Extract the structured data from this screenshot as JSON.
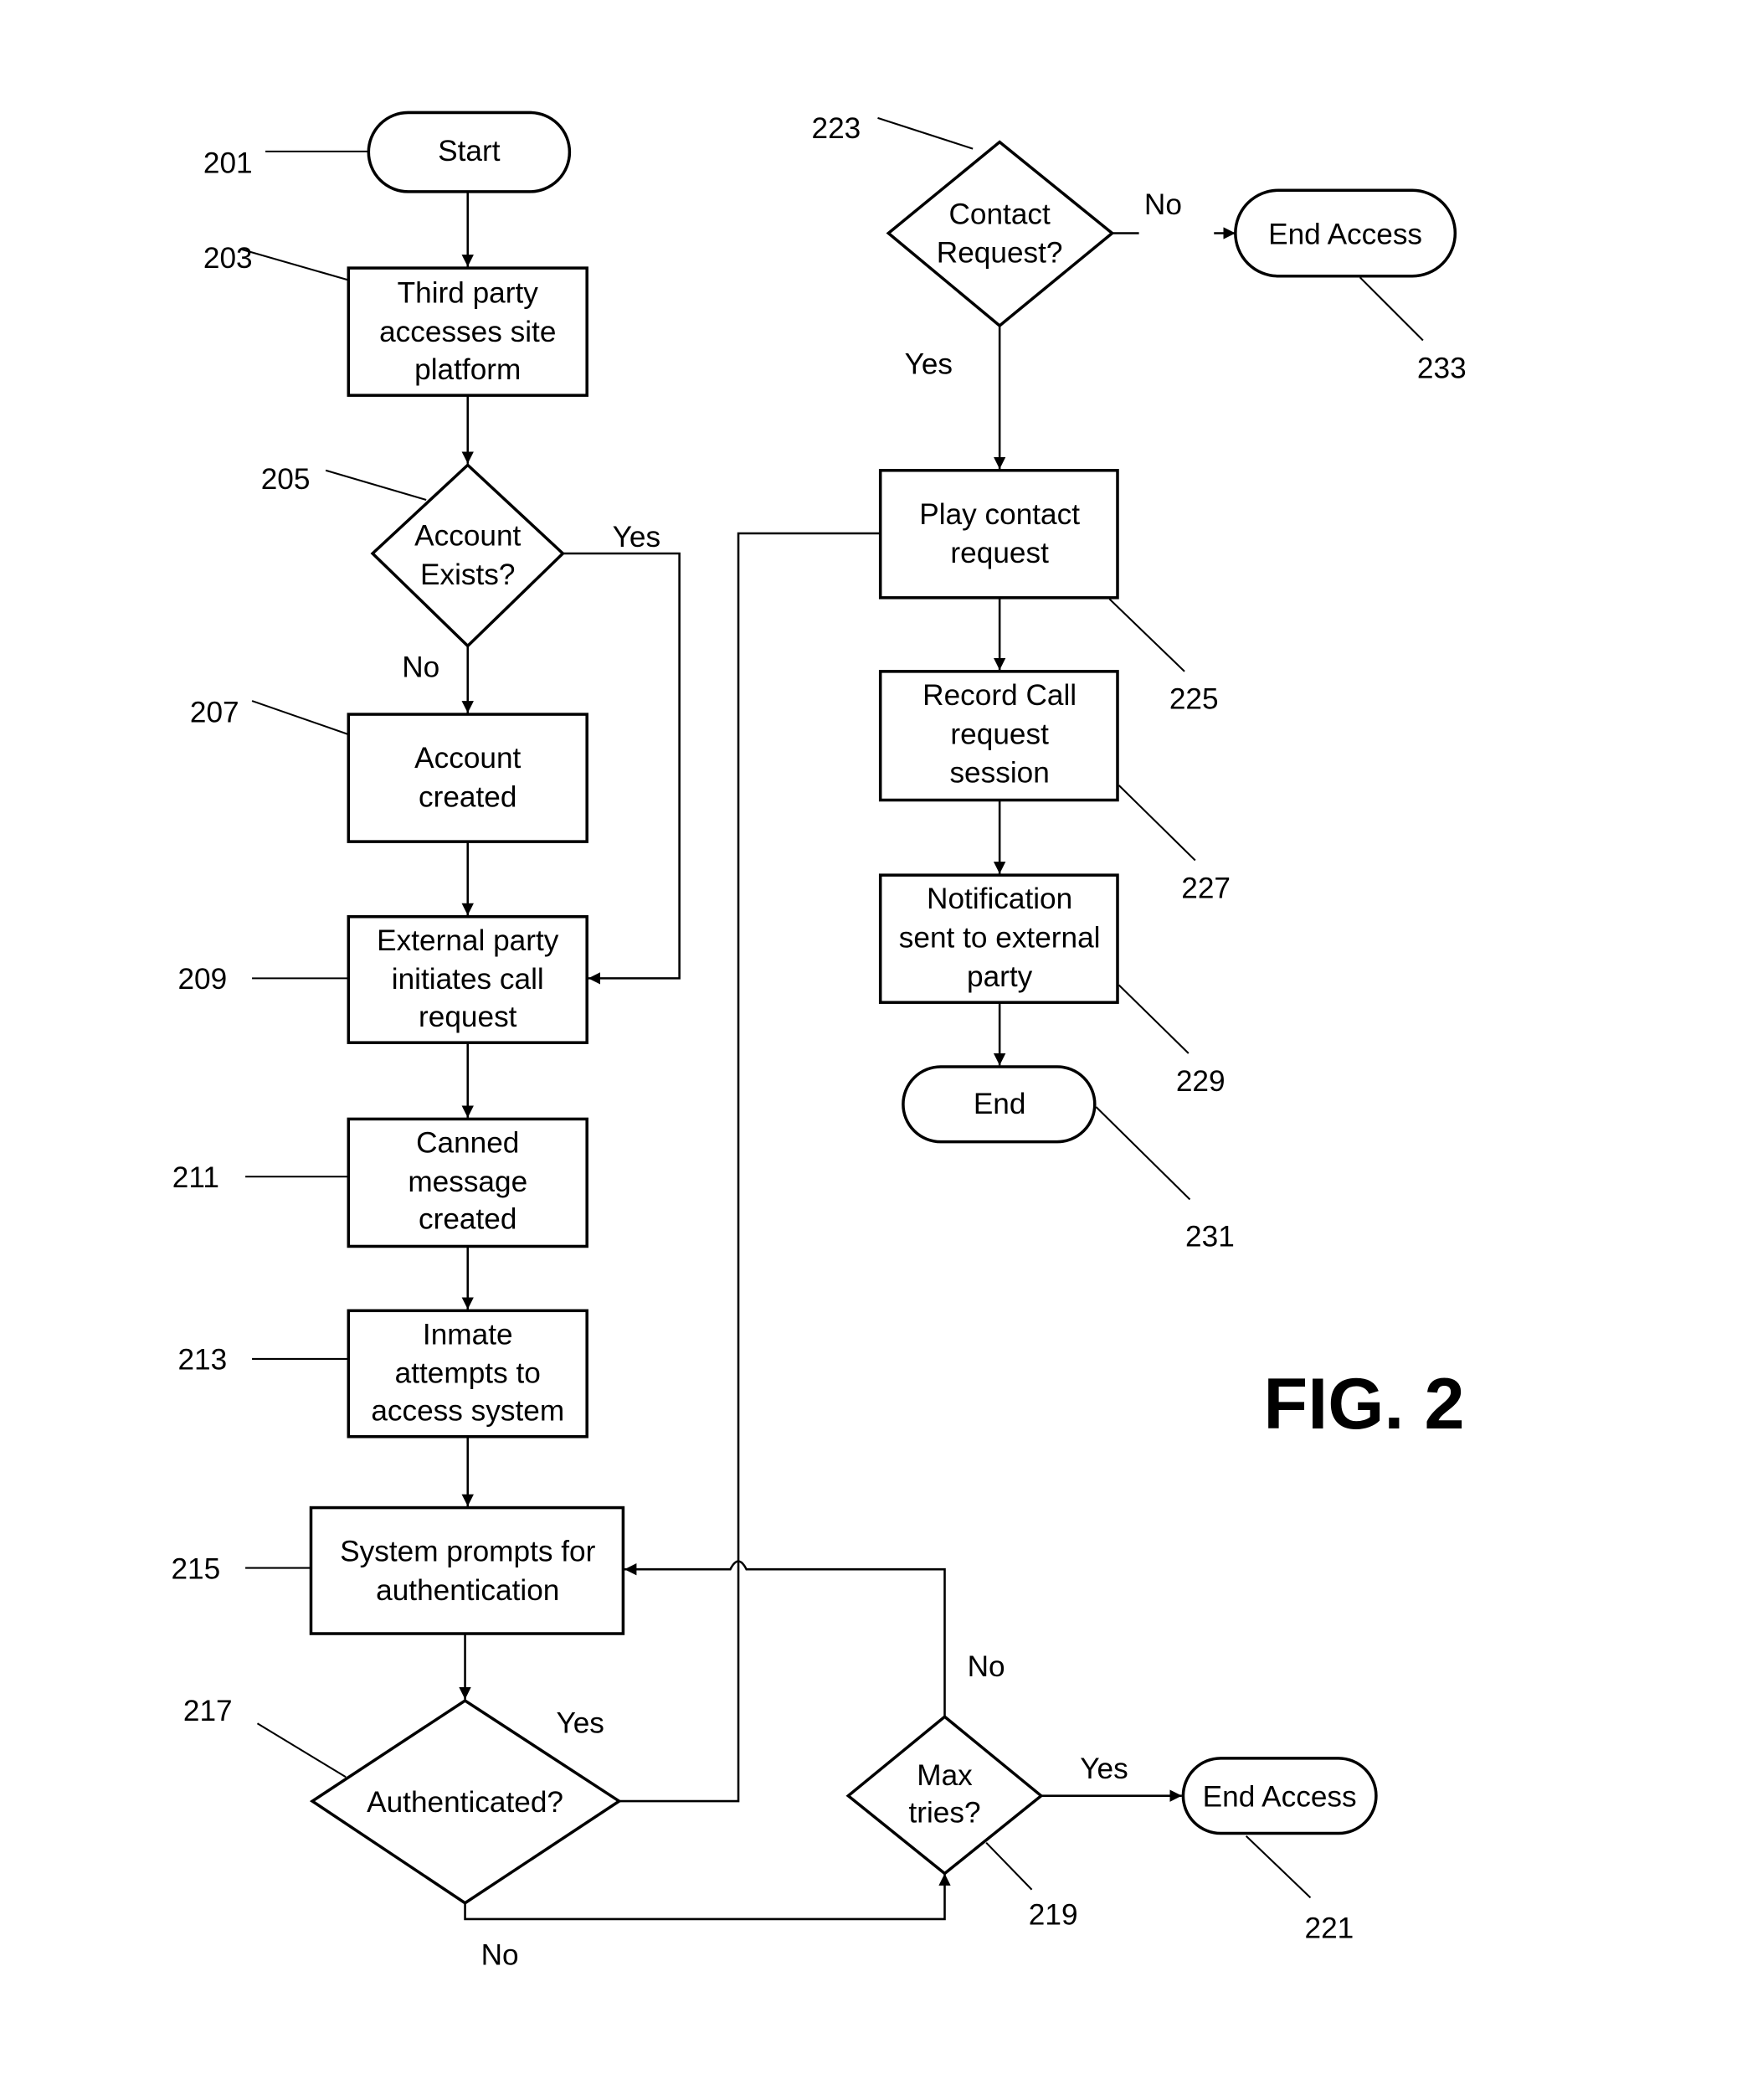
{
  "figure_label": "FIG. 2",
  "nodes": {
    "n201": {
      "ref": "201",
      "lines": [
        "Start"
      ]
    },
    "n203": {
      "ref": "203",
      "lines": [
        "Third party",
        "accesses site",
        "platform"
      ]
    },
    "n205": {
      "ref": "205",
      "lines": [
        "Account",
        "Exists?"
      ]
    },
    "n207": {
      "ref": "207",
      "lines": [
        "Account",
        "created"
      ]
    },
    "n209": {
      "ref": "209",
      "lines": [
        "External party",
        "initiates call",
        "request"
      ]
    },
    "n211": {
      "ref": "211",
      "lines": [
        "Canned",
        "message",
        "created"
      ]
    },
    "n213": {
      "ref": "213",
      "lines": [
        "Inmate",
        "attempts to",
        "access system"
      ]
    },
    "n215": {
      "ref": "215",
      "lines": [
        "System prompts for",
        "authentication"
      ]
    },
    "n217": {
      "ref": "217",
      "lines": [
        "Authenticated?"
      ]
    },
    "n219": {
      "ref": "219",
      "lines": [
        "Max",
        "tries?"
      ]
    },
    "n221": {
      "ref": "221",
      "lines": [
        "End Access"
      ]
    },
    "n223": {
      "ref": "223",
      "lines": [
        "Contact",
        "Request?"
      ]
    },
    "n225": {
      "ref": "225",
      "lines": [
        "Play contact",
        "request"
      ]
    },
    "n227": {
      "ref": "227",
      "lines": [
        "Record Call",
        "request",
        "session"
      ]
    },
    "n229": {
      "ref": "229",
      "lines": [
        "Notification",
        "sent to external",
        "party"
      ]
    },
    "n231": {
      "ref": "231",
      "lines": [
        "End"
      ]
    },
    "n233": {
      "ref": "233",
      "lines": [
        "End Access"
      ]
    }
  },
  "edge_labels": {
    "e205_yes": "Yes",
    "e205_no": "No",
    "e217_yes": "Yes",
    "e217_no": "No",
    "e219_yes": "Yes",
    "e219_no": "No",
    "e223_yes": "Yes",
    "e223_no": "No"
  }
}
